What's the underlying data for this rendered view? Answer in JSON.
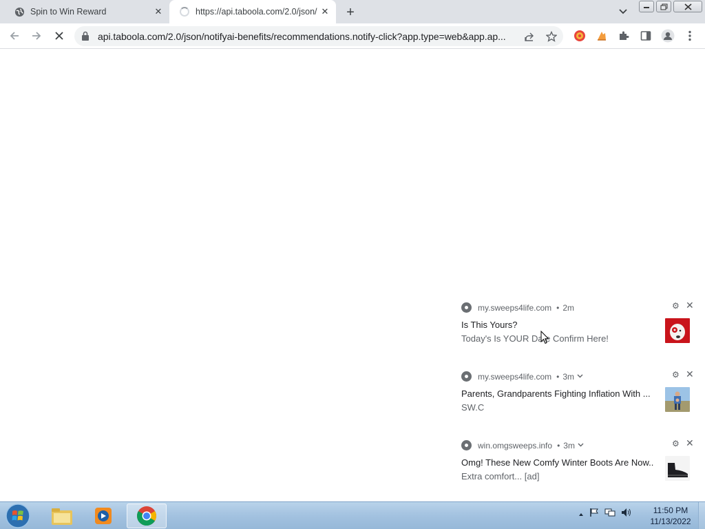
{
  "browser": {
    "tabs": [
      {
        "title": "Spin to Win Reward",
        "favicon": "globe-icon",
        "active": false,
        "loading": false
      },
      {
        "title": "https://api.taboola.com/2.0/json/",
        "favicon": "loading-spinner",
        "active": true,
        "loading": true
      }
    ],
    "address_bar": {
      "url": "api.taboola.com/2.0/json/notifyai-benefits/recommendations.notify-click?app.type=web&app.ap..."
    }
  },
  "notifications": [
    {
      "source": "my.sweeps4life.com",
      "time": "2m",
      "expandable": false,
      "title": "Is This Yours?",
      "body": "Today's  Is YOUR Date Confirm Here!",
      "thumb": "target-dog-thumbnail"
    },
    {
      "source": "my.sweeps4life.com",
      "time": "3m",
      "expandable": true,
      "title": "Parents, Grandparents Fighting Inflation With ...",
      "body": "SW.C",
      "thumb": "family-thumbnail"
    },
    {
      "source": "win.omgsweeps.info",
      "time": "3m",
      "expandable": true,
      "title": "Omg! These New Comfy Winter Boots Are Now...",
      "body": "Extra comfort... [ad]",
      "thumb": "boot-thumbnail"
    }
  ],
  "taskbar": {
    "clock_time": "11:50 PM",
    "clock_date": "11/13/2022"
  },
  "colors": {
    "tabstrip": "#dee1e6",
    "omnibox": "#f1f3f4",
    "taskbar": "#a3c2e0"
  }
}
